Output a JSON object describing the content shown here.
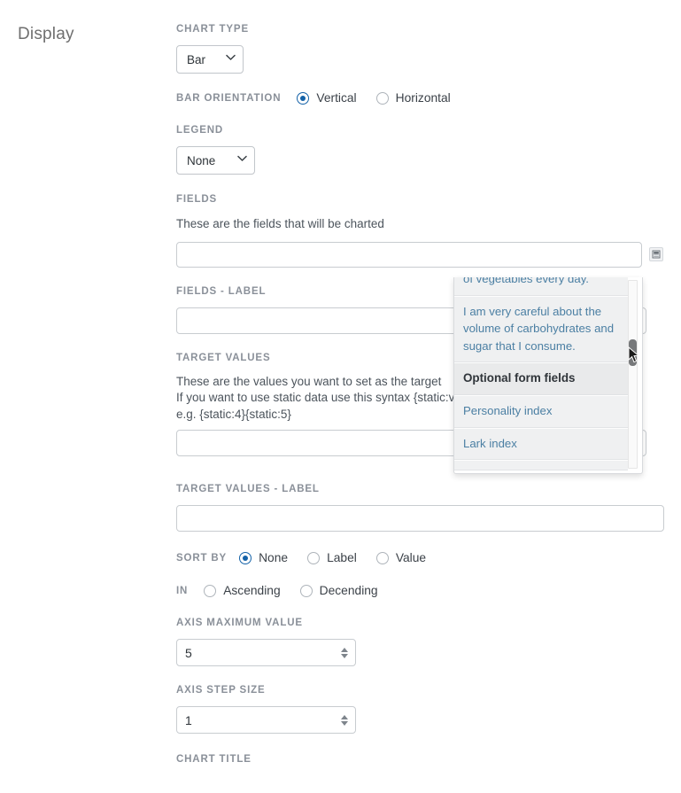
{
  "section": {
    "title": "Display"
  },
  "fields": {
    "chart_type": {
      "label": "CHART TYPE",
      "value": "Bar",
      "caret_icon": "chevron-down-icon"
    },
    "bar_orientation": {
      "label": "BAR ORIENTATION",
      "options": [
        {
          "label": "Vertical",
          "selected": true
        },
        {
          "label": "Horizontal",
          "selected": false
        }
      ]
    },
    "legend": {
      "label": "LEGEND",
      "value": "None",
      "caret_icon": "chevron-down-icon"
    },
    "fields_group": {
      "label": "FIELDS",
      "helper": "These are the fields that will be charted",
      "value": "",
      "placeholder": "",
      "picker_icon": "field-picker-icon"
    },
    "fields_label": {
      "label": "FIELDS - LABEL",
      "value": "",
      "placeholder": ""
    },
    "target_values": {
      "label": "TARGET VALUES",
      "helper_line1": "These are the values you want to set as the target",
      "helper_line2": "If you want to use static data use this syntax {static:value}",
      "helper_line3": "e.g. {static:4}{static:5}",
      "value": "",
      "placeholder": ""
    },
    "target_values_label": {
      "label": "TARGET VALUES - LABEL",
      "value": "",
      "placeholder": ""
    },
    "sort_by": {
      "label": "SORT BY",
      "options": [
        {
          "label": "None",
          "selected": true
        },
        {
          "label": "Label",
          "selected": false
        },
        {
          "label": "Value",
          "selected": false
        }
      ]
    },
    "sort_direction": {
      "label": "IN",
      "options": [
        {
          "label": "Ascending",
          "selected": false
        },
        {
          "label": "Decending",
          "selected": false
        }
      ]
    },
    "axis_maximum_value": {
      "label": "AXIS MAXIMUM VALUE",
      "value": "5",
      "spinner_icon": "number-stepper-icon"
    },
    "axis_step_size": {
      "label": "AXIS STEP SIZE",
      "value": "1",
      "spinner_icon": "number-stepper-icon"
    },
    "chart_title": {
      "label": "CHART TITLE"
    }
  },
  "dropdown": {
    "items": [
      {
        "text": "of vegetables every day.",
        "type": "option"
      },
      {
        "text": "I am very careful about the volume of carbohydrates and sugar that I consume.",
        "type": "option"
      },
      {
        "text": "Optional form fields",
        "type": "group"
      },
      {
        "text": "Personality index",
        "type": "option"
      },
      {
        "text": "Lark index",
        "type": "option"
      }
    ],
    "scrollbar": {
      "name": "dropdown-scrollbar"
    }
  },
  "colors": {
    "radio_accent": "#1462a8",
    "label_grey": "#8a9099",
    "option_blue": "#4b7fa3",
    "scroll_thumb": "#77797b"
  }
}
